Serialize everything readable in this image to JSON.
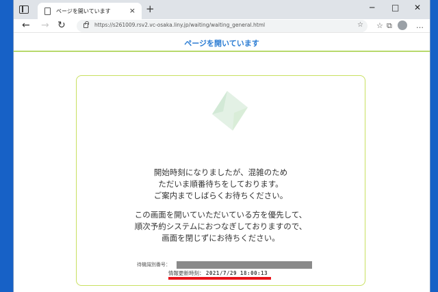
{
  "browser": {
    "tab_title": "ページを開いています",
    "tab_close": "×",
    "new_tab": "+",
    "window_controls": {
      "minimize": "─",
      "maximize": "□",
      "close": "✕"
    },
    "url": "https://s261009.rsv2.vc-osaka.liny.jp/waiting/waiting_general.html",
    "nav": {
      "back": "←",
      "forward": "→",
      "reload": "↻"
    }
  },
  "page": {
    "header_title": "ページを開いています",
    "message1": [
      "開始時刻になりましたが、混雑のため",
      "ただいま順番待ちをしております。",
      "ご案内までしばらくお待ちください。"
    ],
    "message2": [
      "この画面を開いていただいている方を優先して、",
      "順次予約システムにおつなぎしておりますので、",
      "画面を閉じずにお待ちください。"
    ],
    "id_label": "待機識別番号：",
    "update_label": "情報更新時刻：",
    "update_value": "2021/7/29 18:00:13"
  },
  "colors": {
    "desktop": "#1761c6",
    "header_text": "#2b7cd3",
    "accent_green": "#b7d96b",
    "highlight_red": "#e8141b"
  }
}
